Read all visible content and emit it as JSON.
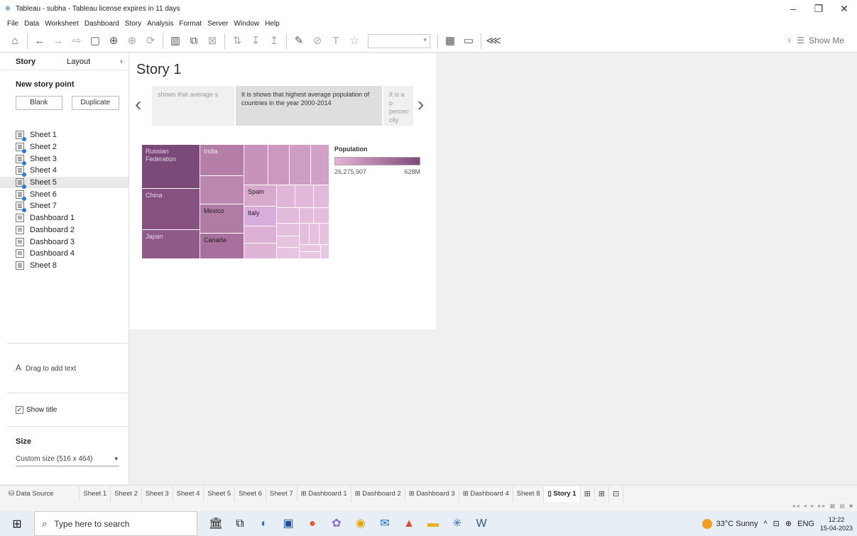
{
  "window": {
    "title": "Tableau - subha - Tableau license expires in 11 days",
    "min": "–",
    "restore": "❐",
    "close": "✕"
  },
  "menu": [
    "File",
    "Data",
    "Worksheet",
    "Dashboard",
    "Story",
    "Analysis",
    "Format",
    "Server",
    "Window",
    "Help"
  ],
  "toolbar": {
    "show_me": "Show Me"
  },
  "sidebar": {
    "tabs": {
      "story": "Story",
      "layout": "Layout"
    },
    "new_story_point": "New story point",
    "blank": "Blank",
    "duplicate": "Duplicate",
    "items": [
      {
        "label": "Sheet 1",
        "kind": "ws"
      },
      {
        "label": "Sheet 2",
        "kind": "ws"
      },
      {
        "label": "Sheet 3",
        "kind": "ws"
      },
      {
        "label": "Sheet 4",
        "kind": "ws"
      },
      {
        "label": "Sheet 5",
        "kind": "ws"
      },
      {
        "label": "Sheet 6",
        "kind": "ws"
      },
      {
        "label": "Sheet 7",
        "kind": "ws"
      },
      {
        "label": "Dashboard 1",
        "kind": "db"
      },
      {
        "label": "Dashboard 2",
        "kind": "db"
      },
      {
        "label": "Dashboard 3",
        "kind": "db"
      },
      {
        "label": "Dashboard 4",
        "kind": "db"
      },
      {
        "label": "Sheet 8",
        "kind": "ws8"
      }
    ],
    "drag_text": "Drag to add text",
    "drag_icon": "A",
    "show_title": "Show title",
    "size_label": "Size",
    "size_value": "Custom size (516 x 464)"
  },
  "story": {
    "title": "Story 1",
    "points": [
      {
        "text": "shows that average s"
      },
      {
        "text": "It is shows that highest average population of countries in the year 2000-2014"
      },
      {
        "text": "It is a p percen city ora"
      }
    ]
  },
  "treemap": {
    "labels": {
      "russia": "Russian Federation",
      "china": "China",
      "japan": "Japan",
      "india": "India",
      "mexico": "Mexico",
      "canada": "Canada",
      "spain": "Spain",
      "italy": "Italy"
    }
  },
  "legend": {
    "title": "Population",
    "min": "26,275,907",
    "max": "628M",
    "color_low": "#e6b4d6",
    "color_high": "#7b4a78"
  },
  "sheet_tabs": {
    "data_source": "Data Source",
    "tabs": [
      "Sheet 1",
      "Sheet 2",
      "Sheet 3",
      "Sheet 4",
      "Sheet 5",
      "Sheet 6",
      "Sheet 7",
      "Dashboard 1",
      "Dashboard 2",
      "Dashboard 3",
      "Dashboard 4",
      "Sheet 8"
    ],
    "current": "Story 1"
  },
  "taskbar": {
    "search_placeholder": "Type here to search",
    "weather": "33°C  Sunny",
    "lang": "ENG",
    "time": "12:22",
    "date": "15-04-2023"
  }
}
